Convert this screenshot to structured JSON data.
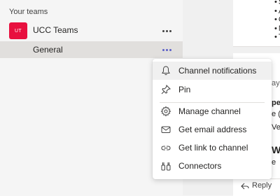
{
  "teams_panel": {
    "section_title": "Your teams",
    "team": {
      "avatar_text": "UT",
      "name": "UCC Teams",
      "avatar_color": "#e8103f"
    },
    "channel": {
      "name": "General"
    }
  },
  "context_menu": {
    "items": [
      {
        "label": "Channel notifications",
        "icon": "bell-icon"
      },
      {
        "label": "Pin",
        "icon": "pin-icon"
      },
      {
        "label": "Manage channel",
        "icon": "gear-icon"
      },
      {
        "label": "Get email address",
        "icon": "envelope-icon"
      },
      {
        "label": "Get link to channel",
        "icon": "link-icon"
      },
      {
        "label": "Connectors",
        "icon": "connectors-icon"
      }
    ]
  },
  "chat": {
    "bullet_fragments": [
      "S",
      "A",
      "O",
      "N",
      "Ta"
    ],
    "fragment_sender": "aya",
    "fragment_bold": "pex",
    "fragment_2": "e (",
    "fragment_3": "Veb",
    "fragment_heading": "W",
    "fragment_4": "e",
    "reply_label": "Reply"
  },
  "colors": {
    "accent": "#5b5fc7",
    "team_avatar": "#e8103f"
  }
}
